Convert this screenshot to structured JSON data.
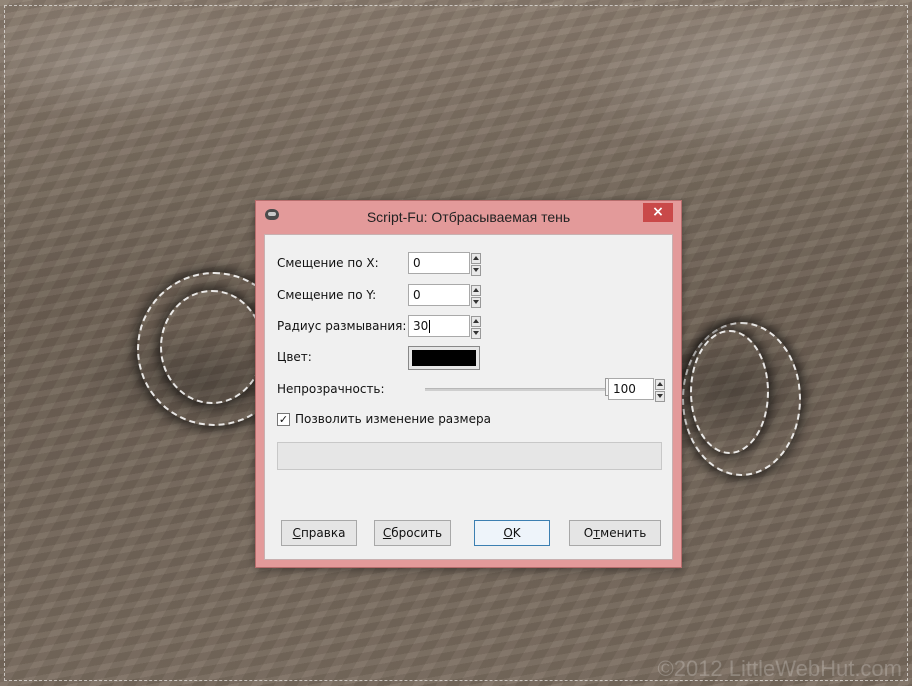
{
  "dialog": {
    "title": "Script-Fu: Отбрасываемая тень",
    "close_label": "×",
    "offset_x": {
      "label": "Смещение по X:",
      "value": "0"
    },
    "offset_y": {
      "label": "Смещение по Y:",
      "value": "0"
    },
    "blur_radius": {
      "label": "Радиус размывания:",
      "value": "30"
    },
    "color": {
      "label": "Цвет:",
      "value": "#000000"
    },
    "opacity": {
      "label": "Непрозрачность:",
      "value": "100",
      "level": 1.0
    },
    "allow_resize": {
      "label": "Позволить изменение размера",
      "checked": true,
      "mark": "✓"
    },
    "buttons": {
      "help_key": "С",
      "help_rest": "правка",
      "reset_key": "С",
      "reset_rest": "бросить",
      "ok_key": "O",
      "ok_rest": "K",
      "cancel_pre": "О",
      "cancel_key": "т",
      "cancel_rest": "менить"
    }
  },
  "canvas": {
    "watermark": "©2012 LittleWebHut.com"
  },
  "colors": {
    "titlebar": "#e39a9a",
    "close_button": "#c94949",
    "dialog_bg": "#f0f0f0"
  }
}
